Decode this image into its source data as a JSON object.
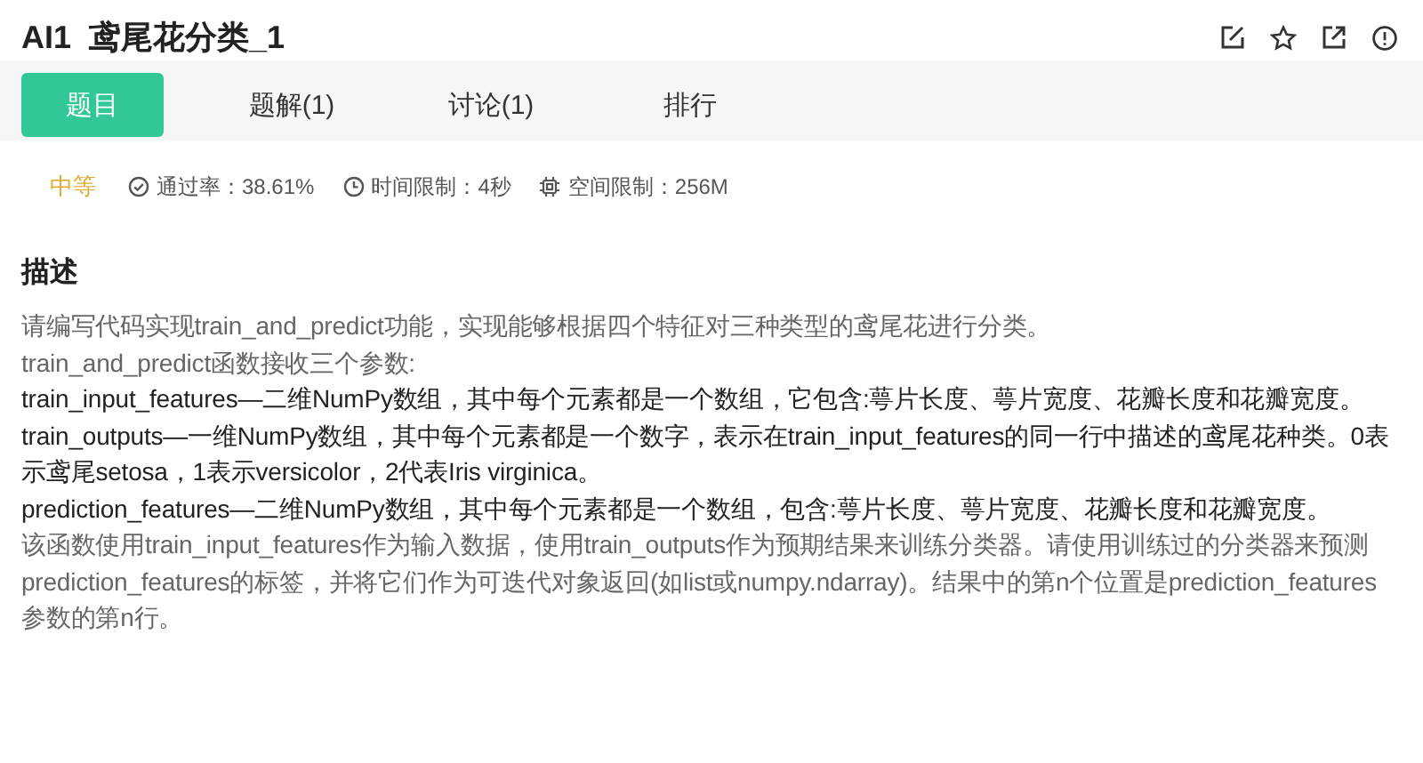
{
  "title": "AI1  鸢尾花分类_1",
  "tabs": [
    {
      "label": "题目",
      "selected": true
    },
    {
      "label": "题解(1)",
      "selected": false
    },
    {
      "label": "讨论(1)",
      "selected": false
    },
    {
      "label": "排行",
      "selected": false
    }
  ],
  "info": {
    "difficulty": "中等",
    "stats": [
      {
        "kind": "pass",
        "text": "通过率：38.61%"
      },
      {
        "kind": "time",
        "text": "时间限制：4秒"
      },
      {
        "kind": "memory",
        "text": "空间限制：256M"
      }
    ]
  },
  "section_heading": "描述",
  "paragraphs": [
    {
      "kind": "muted",
      "text": "请编写代码实现train_and_predict功能，实现能够根据四个特征对三种类型的鸢尾花进行分类。"
    },
    {
      "kind": "muted",
      "text": "train_and_predict函数接收三个参数:"
    },
    {
      "kind": "dark",
      "text": "train_input_features—二维NumPy数组，其中每个元素都是一个数组，它包含:萼片长度、萼片宽度、花瓣长度和花瓣宽度。"
    },
    {
      "kind": "dark",
      "text": "train_outputs—一维NumPy数组，其中每个元素都是一个数字，表示在train_input_features的同一行中描述的鸢尾花种类。0表示鸢尾setosa，1表示versicolor，2代表Iris virginica。"
    },
    {
      "kind": "dark",
      "text": "prediction_features—二维NumPy数组，其中每个元素都是一个数组，包含:萼片长度、萼片宽度、花瓣长度和花瓣宽度。"
    },
    {
      "kind": "muted",
      "text": "该函数使用train_input_features作为输入数据，使用train_outputs作为预期结果来训练分类器。请使用训练过的分类器来预测prediction_features的标签，并将它们作为可迭代对象返回(如list或numpy.ndarray)。结果中的第n个位置是prediction_features参数的第n行。"
    }
  ]
}
